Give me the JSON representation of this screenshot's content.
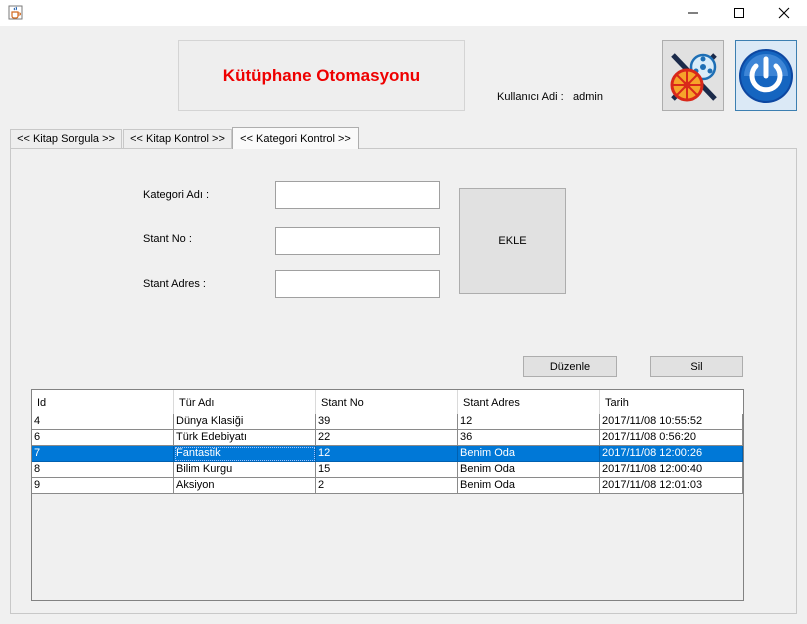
{
  "window": {
    "title": "",
    "minimize": "—",
    "maximize": "☐",
    "close": "✕"
  },
  "header": {
    "title": "Kütüphane Otomasyonu",
    "user_label": "Kullanıcı Adi :",
    "user_value": "admin"
  },
  "tabs": [
    {
      "label": "<< Kitap Sorgula >>"
    },
    {
      "label": "<< Kitap Kontrol >>"
    },
    {
      "label": "<< Kategori Kontrol >>",
      "active": true
    }
  ],
  "form": {
    "category_label": "Kategori Adı :",
    "stand_no_label": "Stant No :",
    "stand_address_label": "Stant Adres :",
    "category_value": "",
    "stand_no_value": "",
    "stand_address_value": "",
    "add_button": "EKLE",
    "edit_button": "Düzenle",
    "delete_button": "Sil"
  },
  "table": {
    "columns": [
      "Id",
      "Tür Adı",
      "Stant No",
      "Stant Adres",
      "Tarih"
    ],
    "rows": [
      [
        "4",
        "Dünya Klasiği",
        "39",
        "12",
        "2017/11/08 10:55:52"
      ],
      [
        "6",
        "Türk Edebiyatı",
        "22",
        "36",
        "2017/11/08 0:56:20"
      ],
      [
        "7",
        "Fantastik",
        "12",
        "Benim Oda",
        "2017/11/08 12:00:26"
      ],
      [
        "8",
        "Bilim Kurgu",
        "15",
        "Benim Oda",
        "2017/11/08 12:00:40"
      ],
      [
        "9",
        "Aksiyon",
        "2",
        "Benim Oda",
        "2017/11/08 12:01:03"
      ]
    ],
    "selected_row": 2
  },
  "icons": {
    "app": "java-cup-icon",
    "reels": "film-reel-icon",
    "power": "power-icon"
  },
  "colors": {
    "title_red": "#ee0000",
    "selection_blue": "#0078d7",
    "power_blue": "#1565c0"
  }
}
